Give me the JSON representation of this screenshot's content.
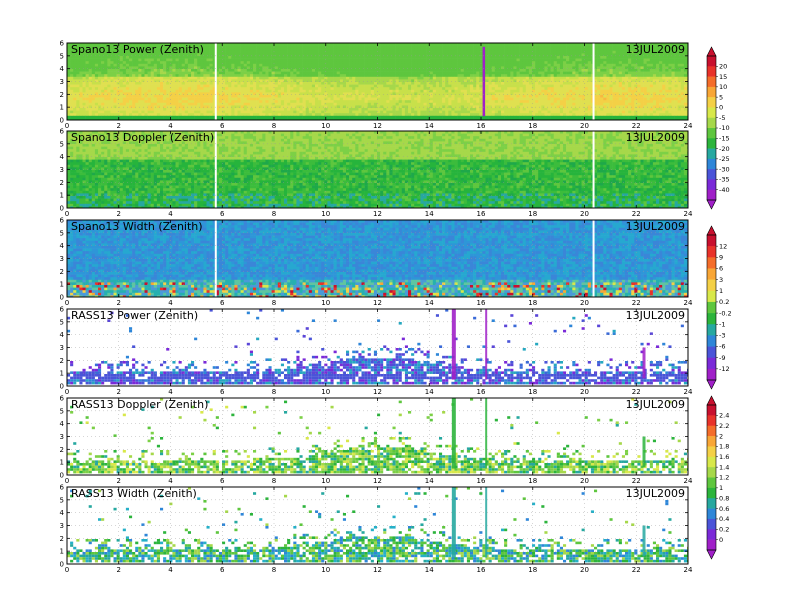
{
  "chart_data": [
    {
      "type": "heatmap",
      "title": "Spano13 Power (Zenith)",
      "date": "13JUL2009",
      "xlim": [
        0,
        24
      ],
      "ylim": [
        0,
        6
      ],
      "xticks": [
        "0",
        "2",
        "4",
        "6",
        "8",
        "10",
        "12",
        "14",
        "16",
        "18",
        "20",
        "22",
        "24"
      ],
      "yticks": [
        "0",
        "1",
        "2",
        "3",
        "4",
        "5",
        "6"
      ],
      "field": "power",
      "colorbar_group": 0
    },
    {
      "type": "heatmap",
      "title": "Spano13 Doppler (Zenith)",
      "date": "13JUL2009",
      "xlim": [
        0,
        24
      ],
      "ylim": [
        0,
        6
      ],
      "xticks": [
        "0",
        "2",
        "4",
        "6",
        "8",
        "10",
        "12",
        "14",
        "16",
        "18",
        "20",
        "22",
        "24"
      ],
      "yticks": [
        "0",
        "1",
        "2",
        "3",
        "4",
        "5",
        "6"
      ],
      "field": "doppler",
      "colorbar_group": 0
    },
    {
      "type": "heatmap",
      "title": "Spano13 Width (Zenith)",
      "date": "13JUL2009",
      "xlim": [
        0,
        24
      ],
      "ylim": [
        0,
        6
      ],
      "xticks": [
        "0",
        "2",
        "4",
        "6",
        "8",
        "10",
        "12",
        "14",
        "16",
        "18",
        "20",
        "22",
        "24"
      ],
      "yticks": [
        "0",
        "1",
        "2",
        "3",
        "4",
        "5",
        "6"
      ],
      "field": "width",
      "colorbar_group": 1
    },
    {
      "type": "heatmap",
      "title": "RASS13 Power (Zenith)",
      "date": "13JUL2009",
      "xlim": [
        0,
        24
      ],
      "ylim": [
        0,
        6
      ],
      "xticks": [
        "0",
        "2",
        "4",
        "6",
        "8",
        "10",
        "12",
        "14",
        "16",
        "18",
        "20",
        "22",
        "24"
      ],
      "yticks": [
        "0",
        "1",
        "2",
        "3",
        "4",
        "5",
        "6"
      ],
      "field": "rass_power",
      "colorbar_group": 1
    },
    {
      "type": "heatmap",
      "title": "RASS13 Doppler (Zenith)",
      "date": "13JUL2009",
      "xlim": [
        0,
        24
      ],
      "ylim": [
        0,
        6
      ],
      "xticks": [
        "0",
        "2",
        "4",
        "6",
        "8",
        "10",
        "12",
        "14",
        "16",
        "18",
        "20",
        "22",
        "24"
      ],
      "yticks": [
        "0",
        "1",
        "2",
        "3",
        "4",
        "5",
        "6"
      ],
      "field": "rass_doppler",
      "colorbar_group": 2
    },
    {
      "type": "heatmap",
      "title": "RASS13 Width (Zenith)",
      "date": "13JUL2009",
      "xlim": [
        0,
        24
      ],
      "ylim": [
        0,
        6
      ],
      "xticks": [
        "0",
        "2",
        "4",
        "6",
        "8",
        "10",
        "12",
        "14",
        "16",
        "18",
        "20",
        "22",
        "24"
      ],
      "yticks": [
        "0",
        "1",
        "2",
        "3",
        "4",
        "5",
        "6"
      ],
      "field": "rass_width",
      "colorbar_group": 2
    }
  ],
  "colorbars": [
    {
      "labels": [
        "20",
        "15",
        "10",
        "5",
        "0",
        "-5",
        "-10",
        "-15",
        "-20",
        "-25",
        "-30",
        "-35",
        "-40"
      ],
      "colors": [
        "#c8102e",
        "#e8322a",
        "#f46d2a",
        "#f8a636",
        "#f4d046",
        "#d8e84a",
        "#a6d84a",
        "#5ec63e",
        "#2cb43c",
        "#26a8a0",
        "#2e86d8",
        "#4a54d8",
        "#7a2ad8",
        "#a020c8"
      ]
    },
    {
      "labels": [
        "12",
        "9",
        "6",
        "3",
        "1",
        "0.2",
        "-0.2",
        "-1",
        "-3",
        "-6",
        "-9",
        "-12"
      ],
      "colors": [
        "#c8102e",
        "#e8322a",
        "#f46d2a",
        "#f8a636",
        "#f4d046",
        "#d8e84a",
        "#5ec63e",
        "#2cb43c",
        "#26a8a0",
        "#2e86d8",
        "#4a54d8",
        "#7a2ad8",
        "#a020c8"
      ]
    },
    {
      "labels": [
        "2.4",
        "2.2",
        "2",
        "1.8",
        "1.6",
        "1.4",
        "1.2",
        "1",
        "0.8",
        "0.6",
        "0.4",
        "0.2",
        "0"
      ],
      "colors": [
        "#c8102e",
        "#e8322a",
        "#f46d2a",
        "#f8a636",
        "#f4d046",
        "#d8e84a",
        "#a6d84a",
        "#5ec63e",
        "#2cb43c",
        "#26a8a0",
        "#2e86d8",
        "#4a54d8",
        "#7a2ad8",
        "#a020c8"
      ]
    }
  ]
}
